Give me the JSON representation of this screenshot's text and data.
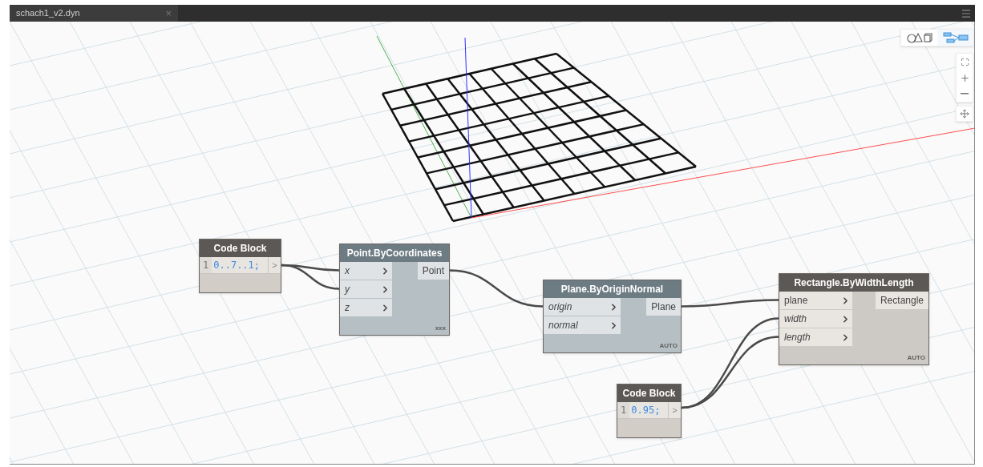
{
  "tab": {
    "title": "schach1_v2.dyn",
    "close": "×"
  },
  "view_toggle": [
    {
      "kind": "geometry",
      "selected": false
    },
    {
      "kind": "graph",
      "selected": true
    }
  ],
  "nodes": [
    {
      "kind": "code",
      "title": "Code Block",
      "line": "1",
      "code": "0..7..1;",
      "output": ">"
    },
    {
      "kind": "function",
      "title": "Point.ByCoordinates",
      "preview": false,
      "inputs": [
        {
          "name": "x",
          "has_default": true
        },
        {
          "name": "y",
          "has_default": true
        },
        {
          "name": "z",
          "has_default": true
        }
      ],
      "outputs": [
        "Point"
      ],
      "lacing": "xxx"
    },
    {
      "kind": "function",
      "title": "Plane.ByOriginNormal",
      "preview": false,
      "inputs": [
        {
          "name": "origin",
          "has_default": true
        },
        {
          "name": "normal",
          "has_default": true
        }
      ],
      "outputs": [
        "Plane"
      ],
      "lacing": "AUTO"
    },
    {
      "kind": "function",
      "title": "Rectangle.ByWidthLength",
      "preview": true,
      "inputs": [
        {
          "name": "plane",
          "has_default": false
        },
        {
          "name": "width",
          "has_default": true
        },
        {
          "name": "length",
          "has_default": true
        }
      ],
      "outputs": [
        "Rectangle"
      ],
      "lacing": "AUTO"
    },
    {
      "kind": "code",
      "title": "Code Block",
      "line": "1",
      "code": "0.95;",
      "output": ">"
    }
  ]
}
